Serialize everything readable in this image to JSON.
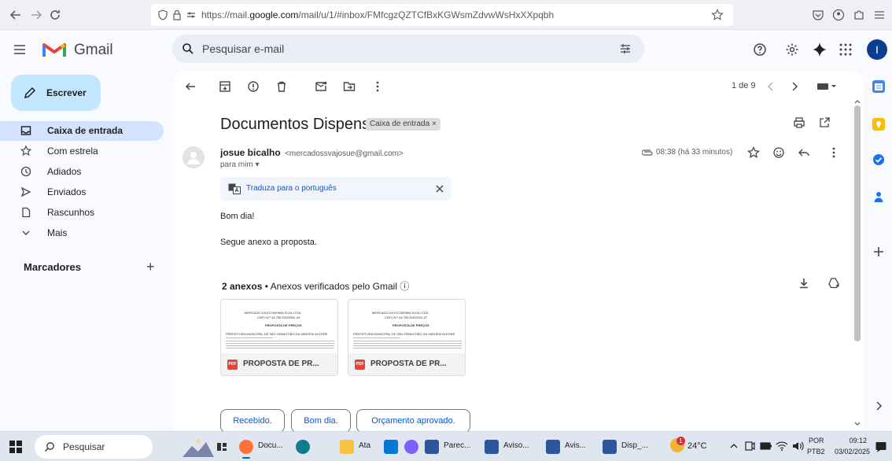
{
  "browser": {
    "url_prefix": "https://mail.",
    "url_domain": "google.com",
    "url_suffix": "/mail/u/1/#inbox/FMfcgzQZTCfBxKGWsmZdvwWsHxXXpqbh"
  },
  "header": {
    "logo_text": "Gmail",
    "search_placeholder": "Pesquisar e-mail",
    "avatar_letter": "I"
  },
  "sidebar": {
    "compose_label": "Escrever",
    "items": [
      {
        "label": "Caixa de entrada",
        "icon": "inbox-icon",
        "active": true
      },
      {
        "label": "Com estrela",
        "icon": "star-icon"
      },
      {
        "label": "Adiados",
        "icon": "clock-icon"
      },
      {
        "label": "Enviados",
        "icon": "send-icon"
      },
      {
        "label": "Rascunhos",
        "icon": "draft-icon"
      },
      {
        "label": "Mais",
        "icon": "chevron-down-icon"
      }
    ],
    "labels_heading": "Marcadores",
    "add_label_symbol": "+"
  },
  "toolbar": {
    "pagination": "1 de 9"
  },
  "email": {
    "subject": "Documentos Dispensa",
    "folder_chip": "Caixa de entrada ×",
    "sender_name": "josue bicalho",
    "sender_email": "<mercadossvajosue@gmail.com>",
    "to_me": "para mim ▾",
    "timestamp": "08:38 (há 33 minutos)",
    "translate_label": "Traduza para o português",
    "body": [
      "Bom dia!",
      "Segue anexo a proposta."
    ],
    "attachments_count": "2 anexos",
    "attachments_note": " •  Anexos verificados pelo Gmail ⓘ",
    "attachments": [
      {
        "name": "PROPOSTA DE PR...",
        "doc_title": "MERCADO DA ECONOMIA SVJA LTDA",
        "doc_cnpj": "CNPJ N.º 44.756.810/0001-44",
        "doc_heading": "PROPOSTA DE PREÇOS",
        "doc_to": "PREFEITURA MUNICIPAL DE SÃO SEBASTIÃO DA VARGEM ALEGRE"
      },
      {
        "name": "PROPOSTA DE PR...",
        "doc_title": "MERCADO DA ECONOMIA SVJA LTDA",
        "doc_cnpj": "CNPJ N.º 44.756.810/0001-47",
        "doc_heading": "PROPOSTA DE PREÇOS",
        "doc_to": "PREFEITURA MUNICIPAL DE SÃO SEBASTIÃO DA VARGEM ALEGRE"
      }
    ],
    "smart_replies": [
      "Recebido.",
      "Bom dia.",
      "Orçamento aprovado."
    ]
  },
  "taskbar": {
    "search_label": "Pesquisar",
    "apps": [
      {
        "label": "Docu...",
        "color": "#ff7139"
      },
      {
        "label": "",
        "color": "#0f7b8f"
      },
      {
        "label": "Ata",
        "color": "#f6c343"
      },
      {
        "label": "",
        "color": "#0078d4"
      },
      {
        "label": "",
        "color": "#7b61ff"
      },
      {
        "label": "Parec...",
        "color": "#2b579a"
      },
      {
        "label": "Aviso...",
        "color": "#2b579a"
      },
      {
        "label": "Avis...",
        "color": "#2b579a"
      },
      {
        "label": "Disp_...",
        "color": "#2b579a"
      }
    ],
    "weather_badge": "1",
    "temperature": "24°C",
    "language": "POR",
    "keyboard": "PTB2",
    "time": "09:12",
    "date": "03/02/2025"
  },
  "colors": {
    "accent": "#0b57d0",
    "compose_bg": "#c2e7ff",
    "active_nav_bg": "#d3e3fd",
    "gmail_red": "#ea4335"
  }
}
